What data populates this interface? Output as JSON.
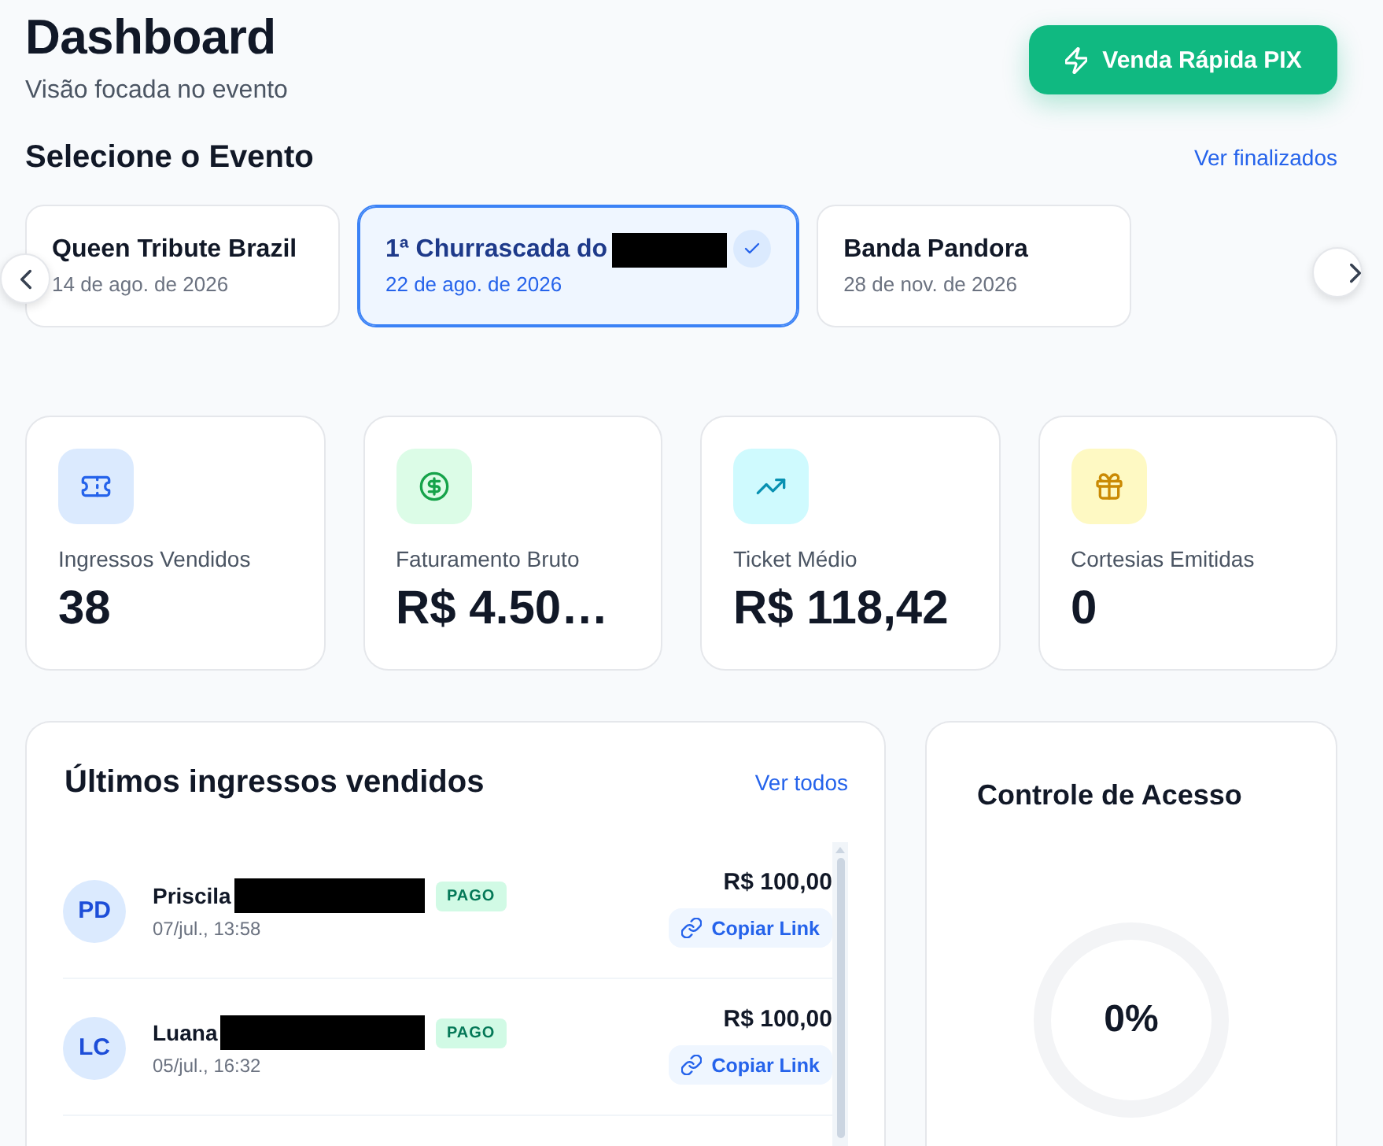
{
  "page": {
    "title": "Dashboard",
    "subtitle": "Visão focada no evento"
  },
  "quick_sale_button": {
    "label": "Venda Rápida PIX"
  },
  "events": {
    "title": "Selecione o Evento",
    "link": "Ver finalizados",
    "items": [
      {
        "title": "Queen Tribute Brazil",
        "date": "14 de ago. de 2026",
        "redacted": false,
        "selected": false
      },
      {
        "title": "1ª Churrascada do",
        "date": "22 de ago. de 2026",
        "redacted": true,
        "selected": true
      },
      {
        "title": "Banda Pandora",
        "date": "28 de nov. de 2026",
        "redacted": false,
        "selected": false
      }
    ]
  },
  "stats": [
    {
      "kind": "tickets",
      "label": "Ingressos Vendidos",
      "value": "38"
    },
    {
      "kind": "revenue",
      "label": "Faturamento Bruto",
      "value": "R$ 4.50…"
    },
    {
      "kind": "average",
      "label": "Ticket Médio",
      "value": "R$ 118,42"
    },
    {
      "kind": "courtesies",
      "label": "Cortesias Emitidas",
      "value": "0"
    }
  ],
  "recent_sales": {
    "title": "Últimos ingressos vendidos",
    "link": "Ver todos",
    "rows": [
      {
        "initials": "PD",
        "name": "Priscila",
        "redacted": true,
        "status": "PAGO",
        "date": "07/jul., 13:58",
        "amount": "R$ 100,00",
        "action": "Copiar Link"
      },
      {
        "initials": "LC",
        "name": "Luana",
        "redacted": true,
        "status": "PAGO",
        "date": "05/jul., 16:32",
        "amount": "R$ 100,00",
        "action": "Copiar Link"
      }
    ]
  },
  "access_control": {
    "title": "Controle de Acesso",
    "reading": "0%"
  }
}
